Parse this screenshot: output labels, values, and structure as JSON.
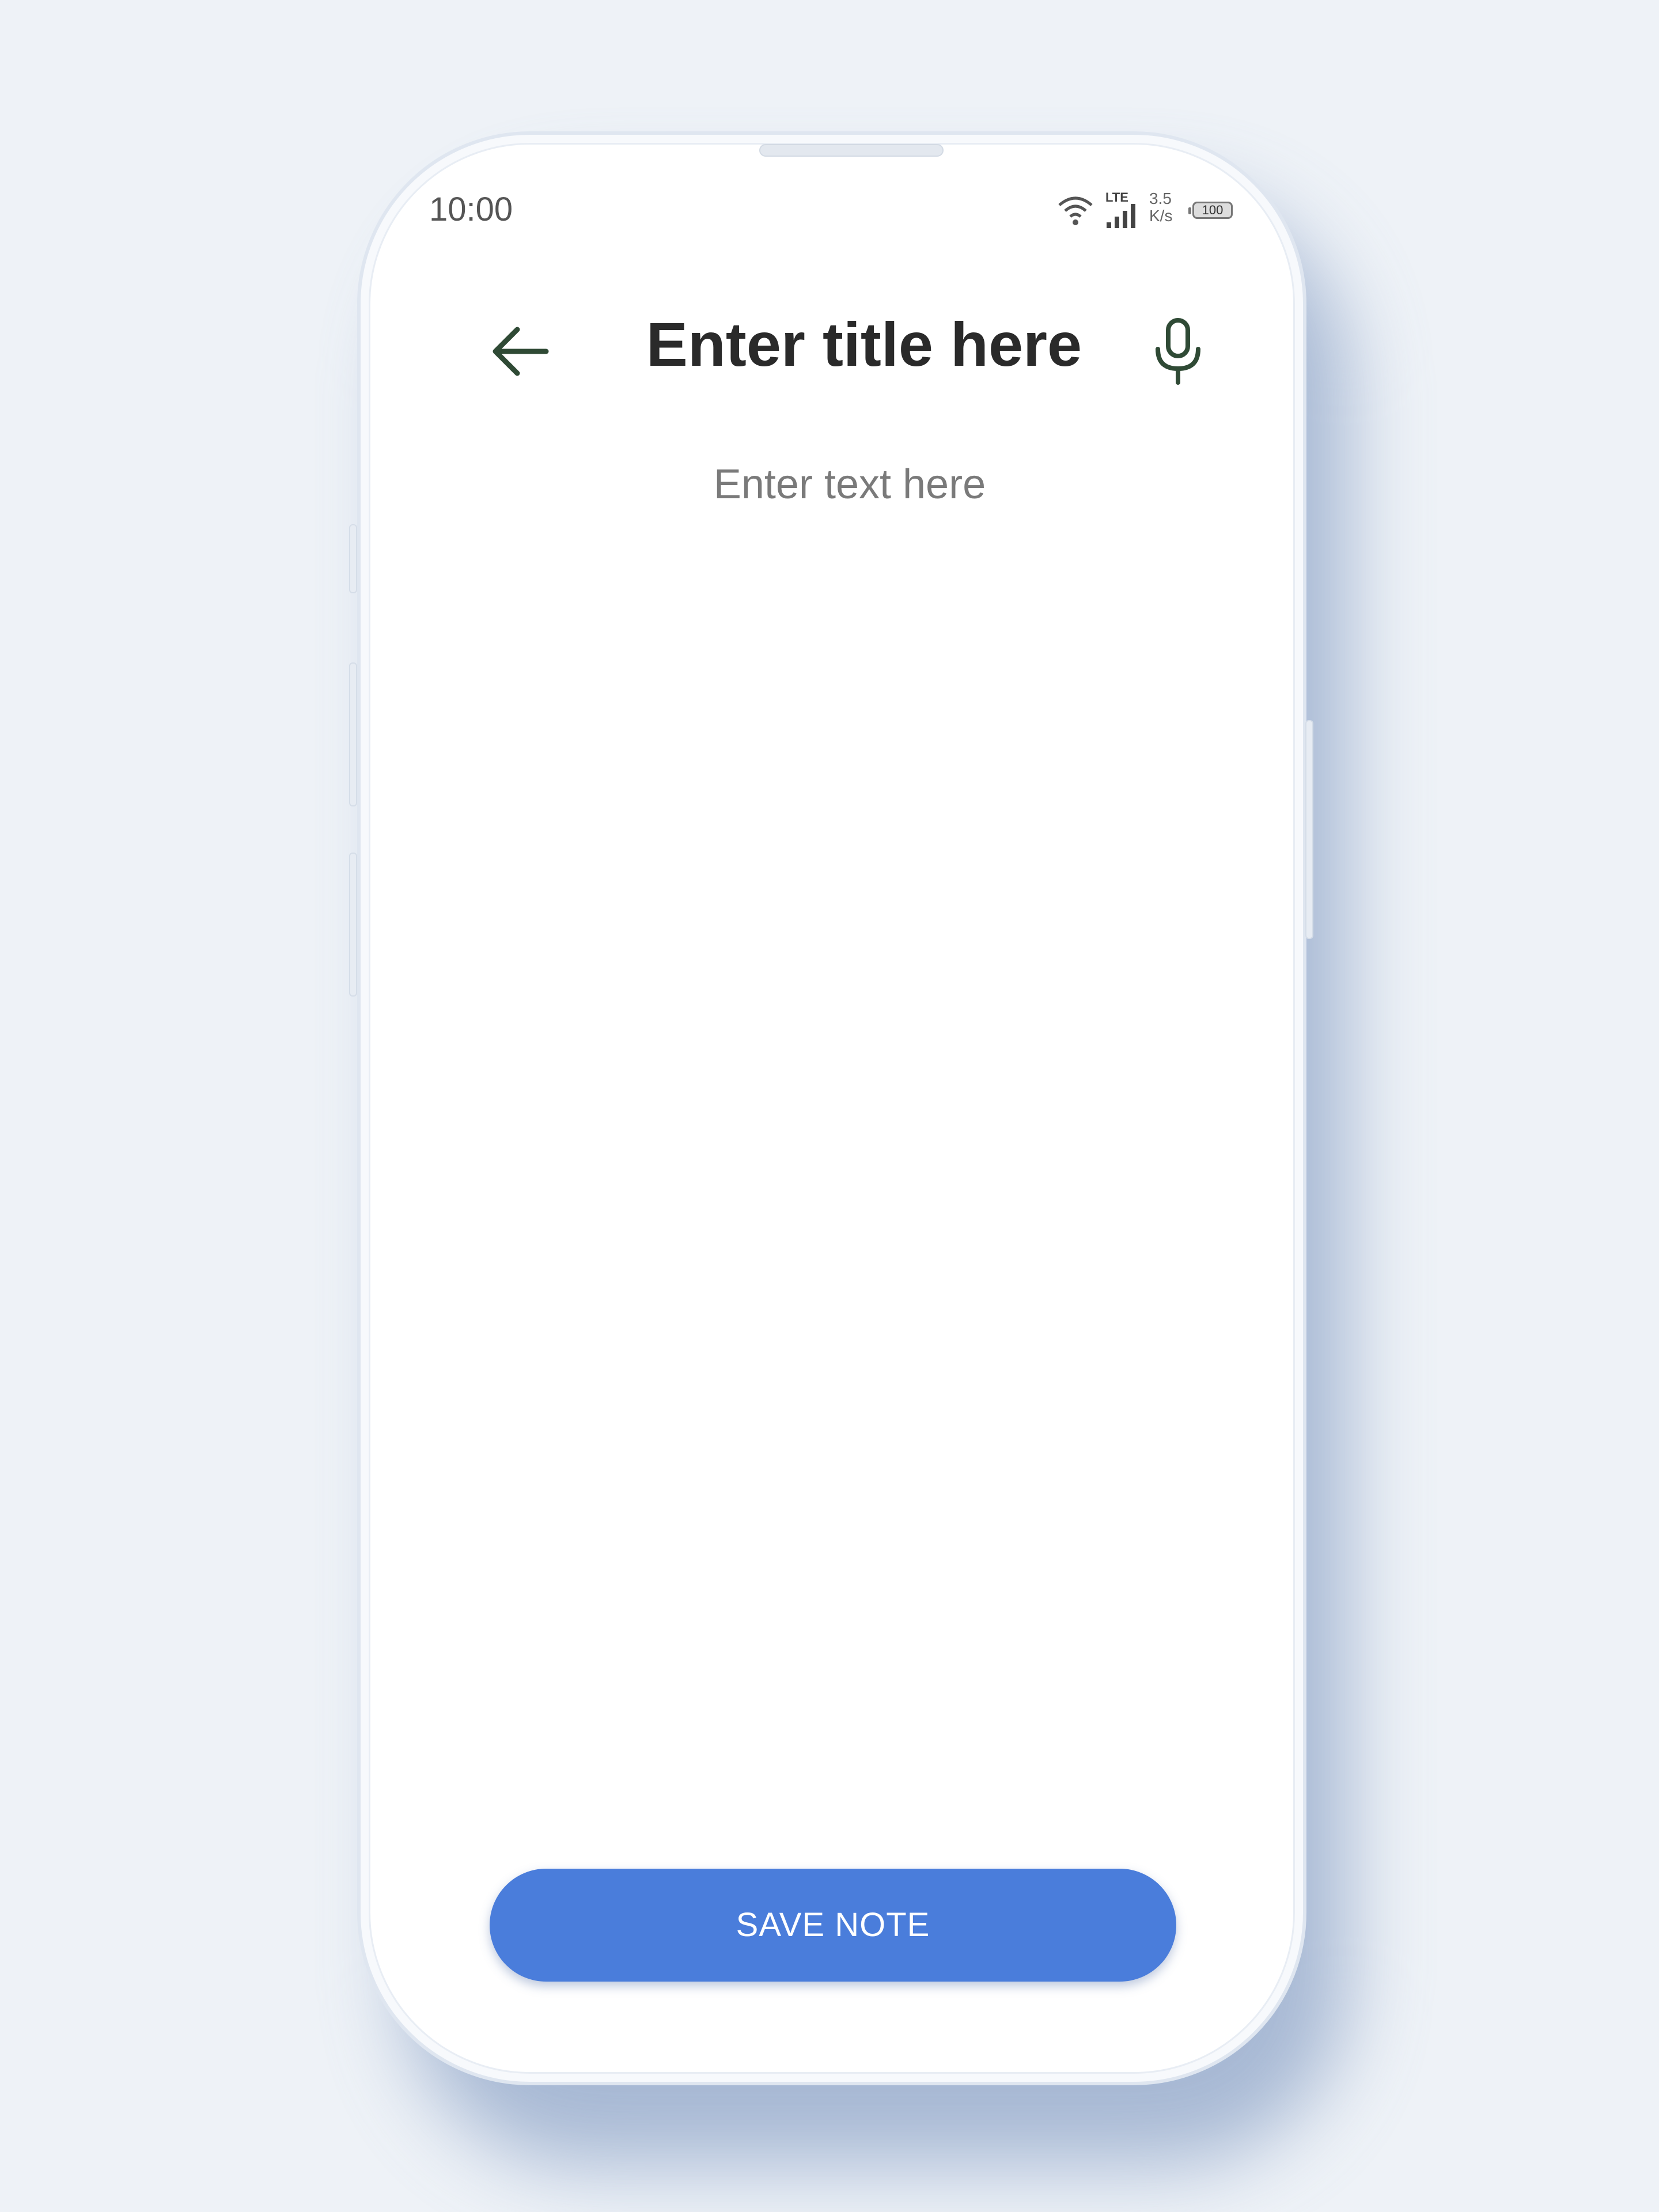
{
  "status_bar": {
    "time": "10:00",
    "network_type": "LTE",
    "net_speed_value": "3.5",
    "net_speed_unit": "K/s",
    "battery_level": "100",
    "icons": [
      "wifi-icon",
      "signal-icon",
      "battery-icon"
    ]
  },
  "header": {
    "back_icon": "arrow-left-icon",
    "title": "Enter title here",
    "mic_icon": "microphone-icon"
  },
  "editor": {
    "body_placeholder": "Enter text here"
  },
  "actions": {
    "save_label": "SAVE NOTE"
  },
  "colors": {
    "accent": "#4a7ddb",
    "icon": "#2f4a35",
    "title_text": "#2a2a2a",
    "placeholder_text": "#7a7a7a",
    "background": "#eef2f7"
  }
}
